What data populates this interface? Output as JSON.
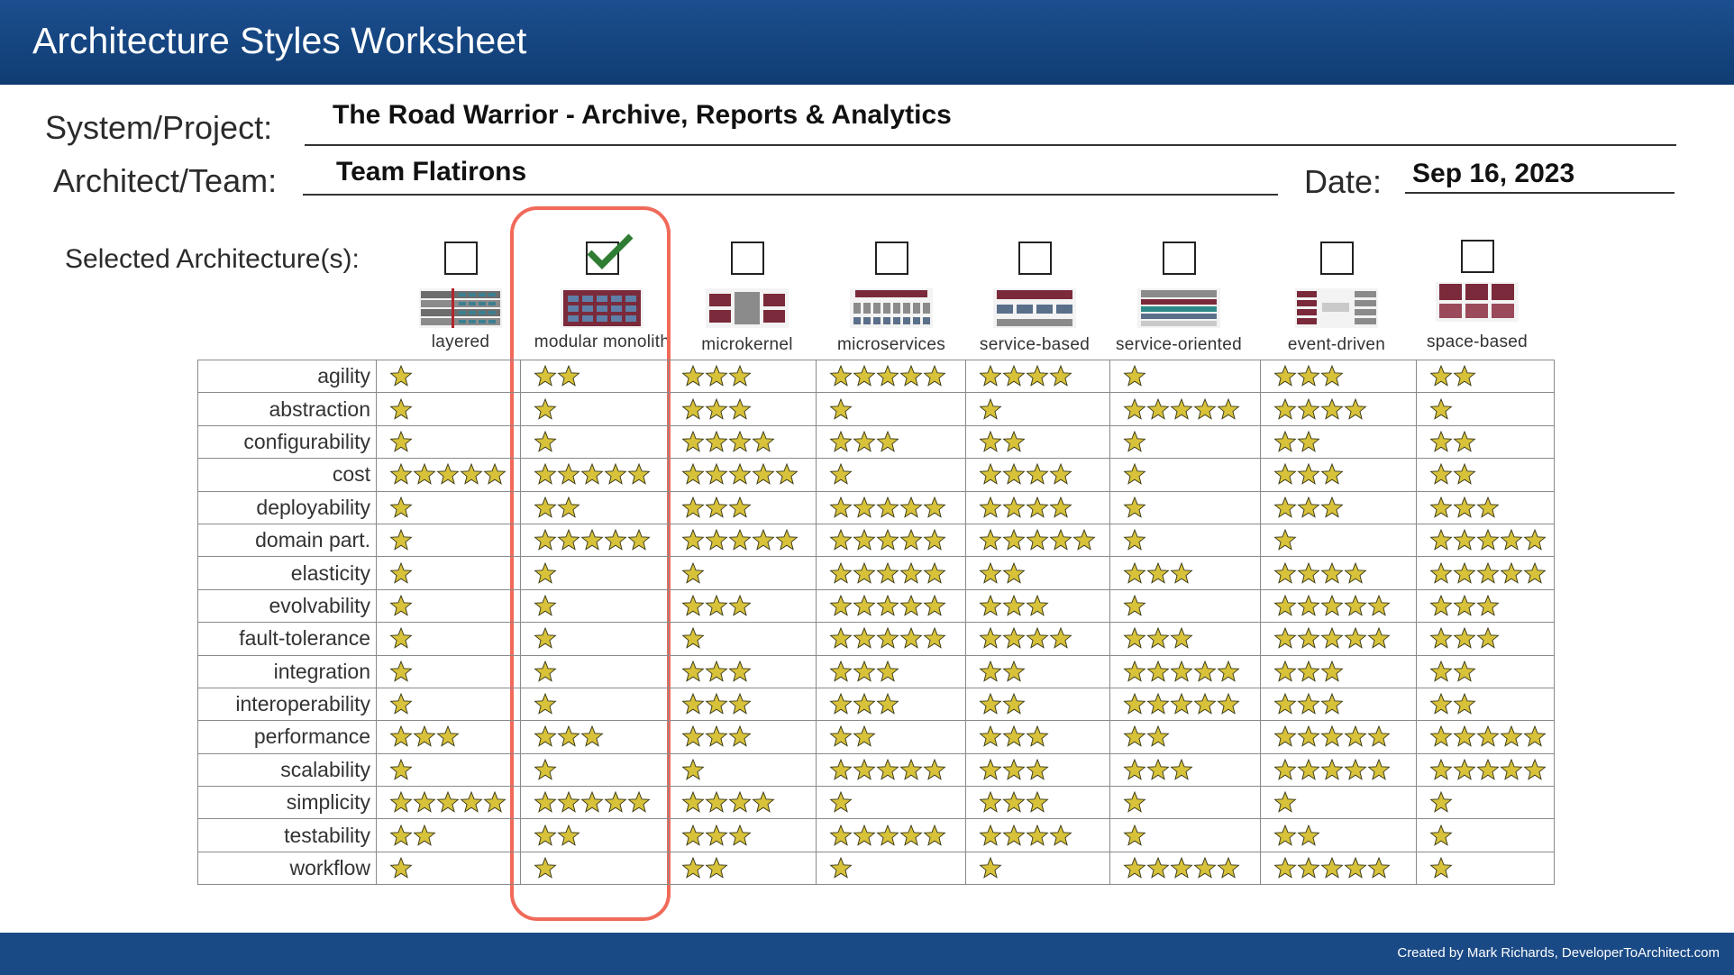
{
  "header": {
    "title": "Architecture Styles Worksheet"
  },
  "form": {
    "system_label": "System/Project:",
    "system_value": "The Road Warrior -  Archive, Reports & Analytics",
    "architect_label": "Architect/Team:",
    "architect_value": "Team Flatirons",
    "date_label": "Date:",
    "date_value": "Sep 16, 2023",
    "selected_label": "Selected Architecture(s):"
  },
  "styles": [
    {
      "name": "layered",
      "checked": false
    },
    {
      "name": "modular monolith",
      "checked": true
    },
    {
      "name": "microkernel",
      "checked": false
    },
    {
      "name": "microservices",
      "checked": false
    },
    {
      "name": "service-based",
      "checked": false
    },
    {
      "name": "service-oriented",
      "checked": false
    },
    {
      "name": "event-driven",
      "checked": false
    },
    {
      "name": "space-based",
      "checked": false
    }
  ],
  "ratings": [
    {
      "characteristic": "agility",
      "stars": [
        1,
        2,
        3,
        5,
        4,
        1,
        3,
        2
      ]
    },
    {
      "characteristic": "abstraction",
      "stars": [
        1,
        1,
        3,
        1,
        1,
        5,
        4,
        1
      ]
    },
    {
      "characteristic": "configurability",
      "stars": [
        1,
        1,
        4,
        3,
        2,
        1,
        2,
        2
      ]
    },
    {
      "characteristic": "cost",
      "stars": [
        5,
        5,
        5,
        1,
        4,
        1,
        3,
        2
      ]
    },
    {
      "characteristic": "deployability",
      "stars": [
        1,
        2,
        3,
        5,
        4,
        1,
        3,
        3
      ]
    },
    {
      "characteristic": "domain part.",
      "stars": [
        1,
        5,
        5,
        5,
        5,
        1,
        1,
        5
      ]
    },
    {
      "characteristic": "elasticity",
      "stars": [
        1,
        1,
        1,
        5,
        2,
        3,
        4,
        5
      ]
    },
    {
      "characteristic": "evolvability",
      "stars": [
        1,
        1,
        3,
        5,
        3,
        1,
        5,
        3
      ]
    },
    {
      "characteristic": "fault-tolerance",
      "stars": [
        1,
        1,
        1,
        5,
        4,
        3,
        5,
        3
      ]
    },
    {
      "characteristic": "integration",
      "stars": [
        1,
        1,
        3,
        3,
        2,
        5,
        3,
        2
      ]
    },
    {
      "characteristic": "interoperability",
      "stars": [
        1,
        1,
        3,
        3,
        2,
        5,
        3,
        2
      ]
    },
    {
      "characteristic": "performance",
      "stars": [
        3,
        3,
        3,
        2,
        3,
        2,
        5,
        5
      ]
    },
    {
      "characteristic": "scalability",
      "stars": [
        1,
        1,
        1,
        5,
        3,
        3,
        5,
        5
      ]
    },
    {
      "characteristic": "simplicity",
      "stars": [
        5,
        5,
        4,
        1,
        3,
        1,
        1,
        1
      ]
    },
    {
      "characteristic": "testability",
      "stars": [
        2,
        2,
        3,
        5,
        4,
        1,
        2,
        1
      ]
    },
    {
      "characteristic": "workflow",
      "stars": [
        1,
        1,
        2,
        1,
        1,
        5,
        5,
        1
      ]
    }
  ],
  "footer": {
    "credit": "Created by Mark Richards, DeveloperToArchitect.com"
  },
  "colors": {
    "header": "#0f3c72",
    "footer": "#1a4a86",
    "highlight": "#f06a5a",
    "check": "#2e7d32",
    "star": "#d8c23a"
  }
}
